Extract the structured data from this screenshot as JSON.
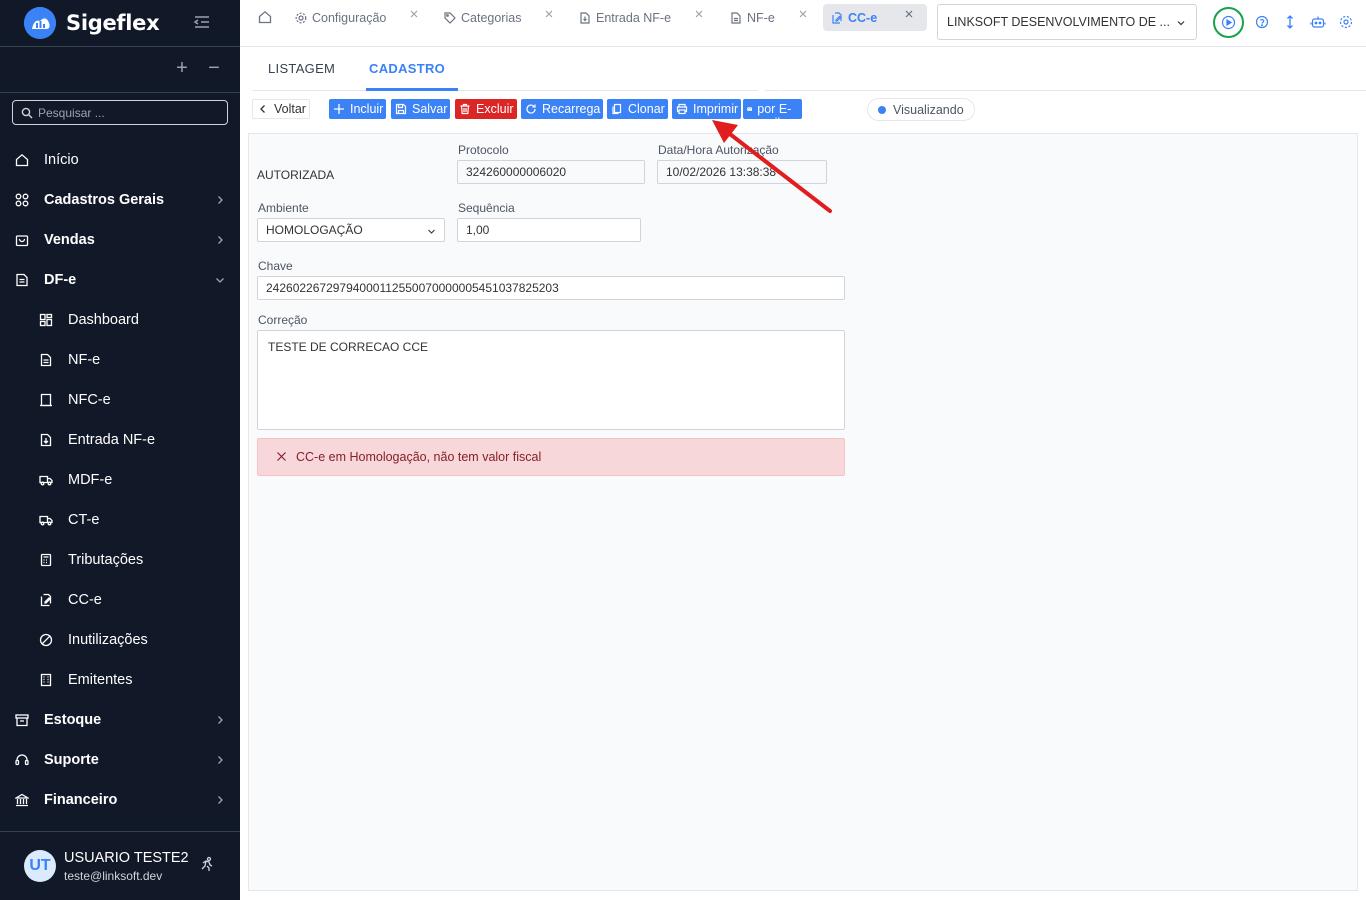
{
  "app": {
    "name": "Sigeflex"
  },
  "sidebar": {
    "search_placeholder": "Pesquisar ...",
    "items": [
      {
        "label": "Início",
        "icon": "home-icon"
      },
      {
        "label": "Cadastros Gerais",
        "icon": "grid-icon"
      },
      {
        "label": "Vendas",
        "icon": "shopping-bag-icon"
      },
      {
        "label": "DF-e",
        "icon": "document-icon"
      },
      {
        "label": "Dashboard",
        "icon": "dashboard-icon"
      },
      {
        "label": "NF-e",
        "icon": "file-text-icon"
      },
      {
        "label": "NFC-e",
        "icon": "receipt-icon"
      },
      {
        "label": "Entrada NF-e",
        "icon": "file-import-icon"
      },
      {
        "label": "MDF-e",
        "icon": "truck-icon"
      },
      {
        "label": "CT-e",
        "icon": "truck-icon"
      },
      {
        "label": "Tributações",
        "icon": "calculator-icon"
      },
      {
        "label": "CC-e",
        "icon": "edit-document-icon"
      },
      {
        "label": "Inutilizações",
        "icon": "ban-icon"
      },
      {
        "label": "Emitentes",
        "icon": "building-icon"
      },
      {
        "label": "Estoque",
        "icon": "archive-icon"
      },
      {
        "label": "Suporte",
        "icon": "headset-icon"
      },
      {
        "label": "Financeiro",
        "icon": "bank-icon"
      }
    ],
    "user": {
      "initials": "UT",
      "name": "USUARIO TESTE2",
      "email": "teste@linksoft.dev"
    }
  },
  "topbar": {
    "tabs": [
      {
        "label": "Configuração"
      },
      {
        "label": "Categorias"
      },
      {
        "label": "Entrada NF-e"
      },
      {
        "label": "NF-e"
      },
      {
        "label": "CC-e"
      }
    ],
    "company": "LINKSOFT DESENVOLVIMENTO DE ..."
  },
  "subtabs": {
    "list": "LISTAGEM",
    "form": "CADASTRO"
  },
  "toolbar": {
    "back": "Voltar",
    "add": "Incluir",
    "save": "Salvar",
    "delete": "Excluir",
    "reload": "Recarrega",
    "clone": "Clonar",
    "print": "Imprimir",
    "email": "Enviar por E-mail",
    "status": "Visualizando"
  },
  "form": {
    "status_value": "AUTORIZADA",
    "protocolo_label": "Protocolo",
    "protocolo_value": "324260000006020",
    "data_label": "Data/Hora Autorização",
    "data_value": "10/02/2026 13:38:38",
    "ambiente_label": "Ambiente",
    "ambiente_value": "HOMOLOGAÇÃO",
    "sequencia_label": "Sequência",
    "sequencia_value": "1,00",
    "chave_label": "Chave",
    "chave_value": "24260226729794000112550070000005451037825203",
    "correcao_label": "Correção",
    "correcao_value": "TESTE DE CORRECAO CCE",
    "alert": "CC-e em Homologação, não tem valor fiscal"
  },
  "colors": {
    "primary": "#3b82f6",
    "danger": "#dc2626",
    "sidebar": "#111827",
    "annotation_arrow": "#e11d1d"
  }
}
